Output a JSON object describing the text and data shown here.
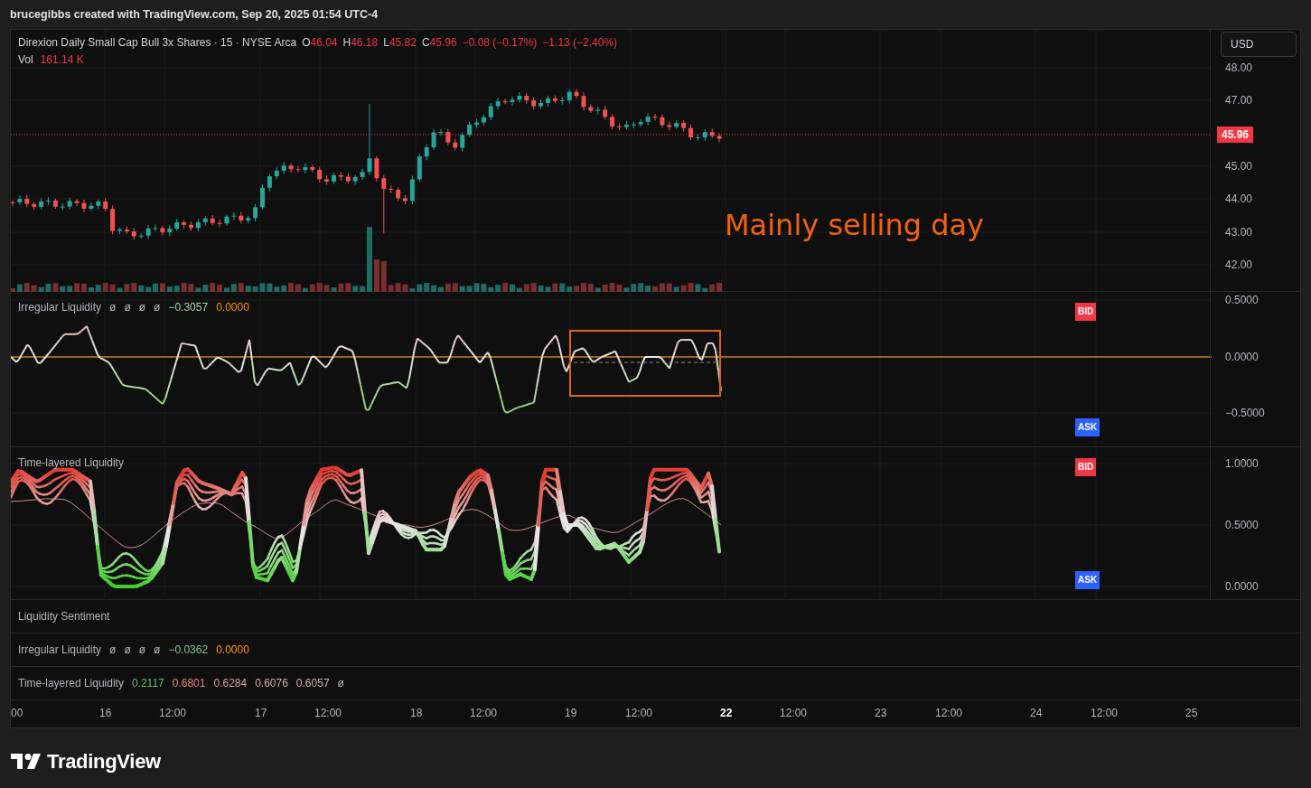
{
  "header": {
    "attribution": "brucegibbs created with TradingView.com, Sep 20, 2025 01:54 UTC-4"
  },
  "price_pane": {
    "symbol": "Direxion Daily Small Cap Bull 3x Shares · 15 · NYSE Arca",
    "ohlc": [
      {
        "label": "O",
        "value": "46.04"
      },
      {
        "label": "H",
        "value": "46.18"
      },
      {
        "label": "L",
        "value": "45.82"
      },
      {
        "label": "C",
        "value": "45.96"
      }
    ],
    "changes": [
      "−0.08 (−0.17%)",
      "−1.13 (−2.40%)"
    ],
    "volume_label": "Vol",
    "volume": "161.14 K",
    "currency": "USD",
    "ticks": [
      "48.00",
      "47.00",
      "45.00",
      "44.00",
      "43.00",
      "42.00"
    ],
    "last_price": "45.96",
    "annotation": "Mainly selling day"
  },
  "irregular_pane": {
    "title": "Irregular Liquidity",
    "values": [
      {
        "text": "ø",
        "color": "#b2b5be"
      },
      {
        "text": "ø",
        "color": "#b2b5be"
      },
      {
        "text": "ø",
        "color": "#b2b5be"
      },
      {
        "text": "ø",
        "color": "#b2b5be"
      },
      {
        "text": "−0.3057",
        "color": "#a5d6a7"
      },
      {
        "text": "0.0000",
        "color": "#ff9800"
      }
    ],
    "ticks": [
      "0.5000",
      "0.0000",
      "−0.5000"
    ],
    "badges": [
      {
        "text": "BID",
        "color": "#f23645"
      },
      {
        "text": "ASK",
        "color": "#2962ff"
      }
    ]
  },
  "layered_pane": {
    "title": "Time-layered Liquidity",
    "ticks": [
      "1.0000",
      "0.5000",
      "0.0000"
    ],
    "badges": [
      {
        "text": "BID",
        "color": "#f23645"
      },
      {
        "text": "ASK",
        "color": "#2962ff"
      }
    ]
  },
  "sentiment_table": {
    "title": "Liquidity Sentiment",
    "rows": [
      {
        "label": "Irregular Liquidity",
        "values": [
          {
            "text": "ø",
            "color": "#b2b5be"
          },
          {
            "text": "ø",
            "color": "#b2b5be"
          },
          {
            "text": "ø",
            "color": "#b2b5be"
          },
          {
            "text": "ø",
            "color": "#b2b5be"
          },
          {
            "text": "−0.0362",
            "color": "#81c784"
          },
          {
            "text": "0.0000",
            "color": "#ff9800"
          }
        ]
      },
      {
        "label": "Time-layered Liquidity",
        "values": [
          {
            "text": "0.2117",
            "color": "#66bb6a"
          },
          {
            "text": "0.6801",
            "color": "#e08a80"
          },
          {
            "text": "0.6284",
            "color": "#d9a49e"
          },
          {
            "text": "0.6076",
            "color": "#d6b0ab"
          },
          {
            "text": "0.6057",
            "color": "#d4b6b2"
          },
          {
            "text": "ø",
            "color": "#b2b5be"
          }
        ]
      }
    ]
  },
  "time_axis": [
    {
      "label": "00",
      "selected": false
    },
    {
      "label": "16",
      "selected": false
    },
    {
      "label": "12:00",
      "selected": false
    },
    {
      "label": "17",
      "selected": false
    },
    {
      "label": "12:00",
      "selected": false
    },
    {
      "label": "18",
      "selected": false
    },
    {
      "label": "12:00",
      "selected": false
    },
    {
      "label": "19",
      "selected": false
    },
    {
      "label": "12:00",
      "selected": false
    },
    {
      "label": "22",
      "selected": true
    },
    {
      "label": "12:00",
      "selected": false
    },
    {
      "label": "23",
      "selected": false
    },
    {
      "label": "12:00",
      "selected": false
    },
    {
      "label": "24",
      "selected": false
    },
    {
      "label": "12:00",
      "selected": false
    },
    {
      "label": "25",
      "selected": false
    }
  ],
  "footer": {
    "logo_text": "TradingView"
  }
}
